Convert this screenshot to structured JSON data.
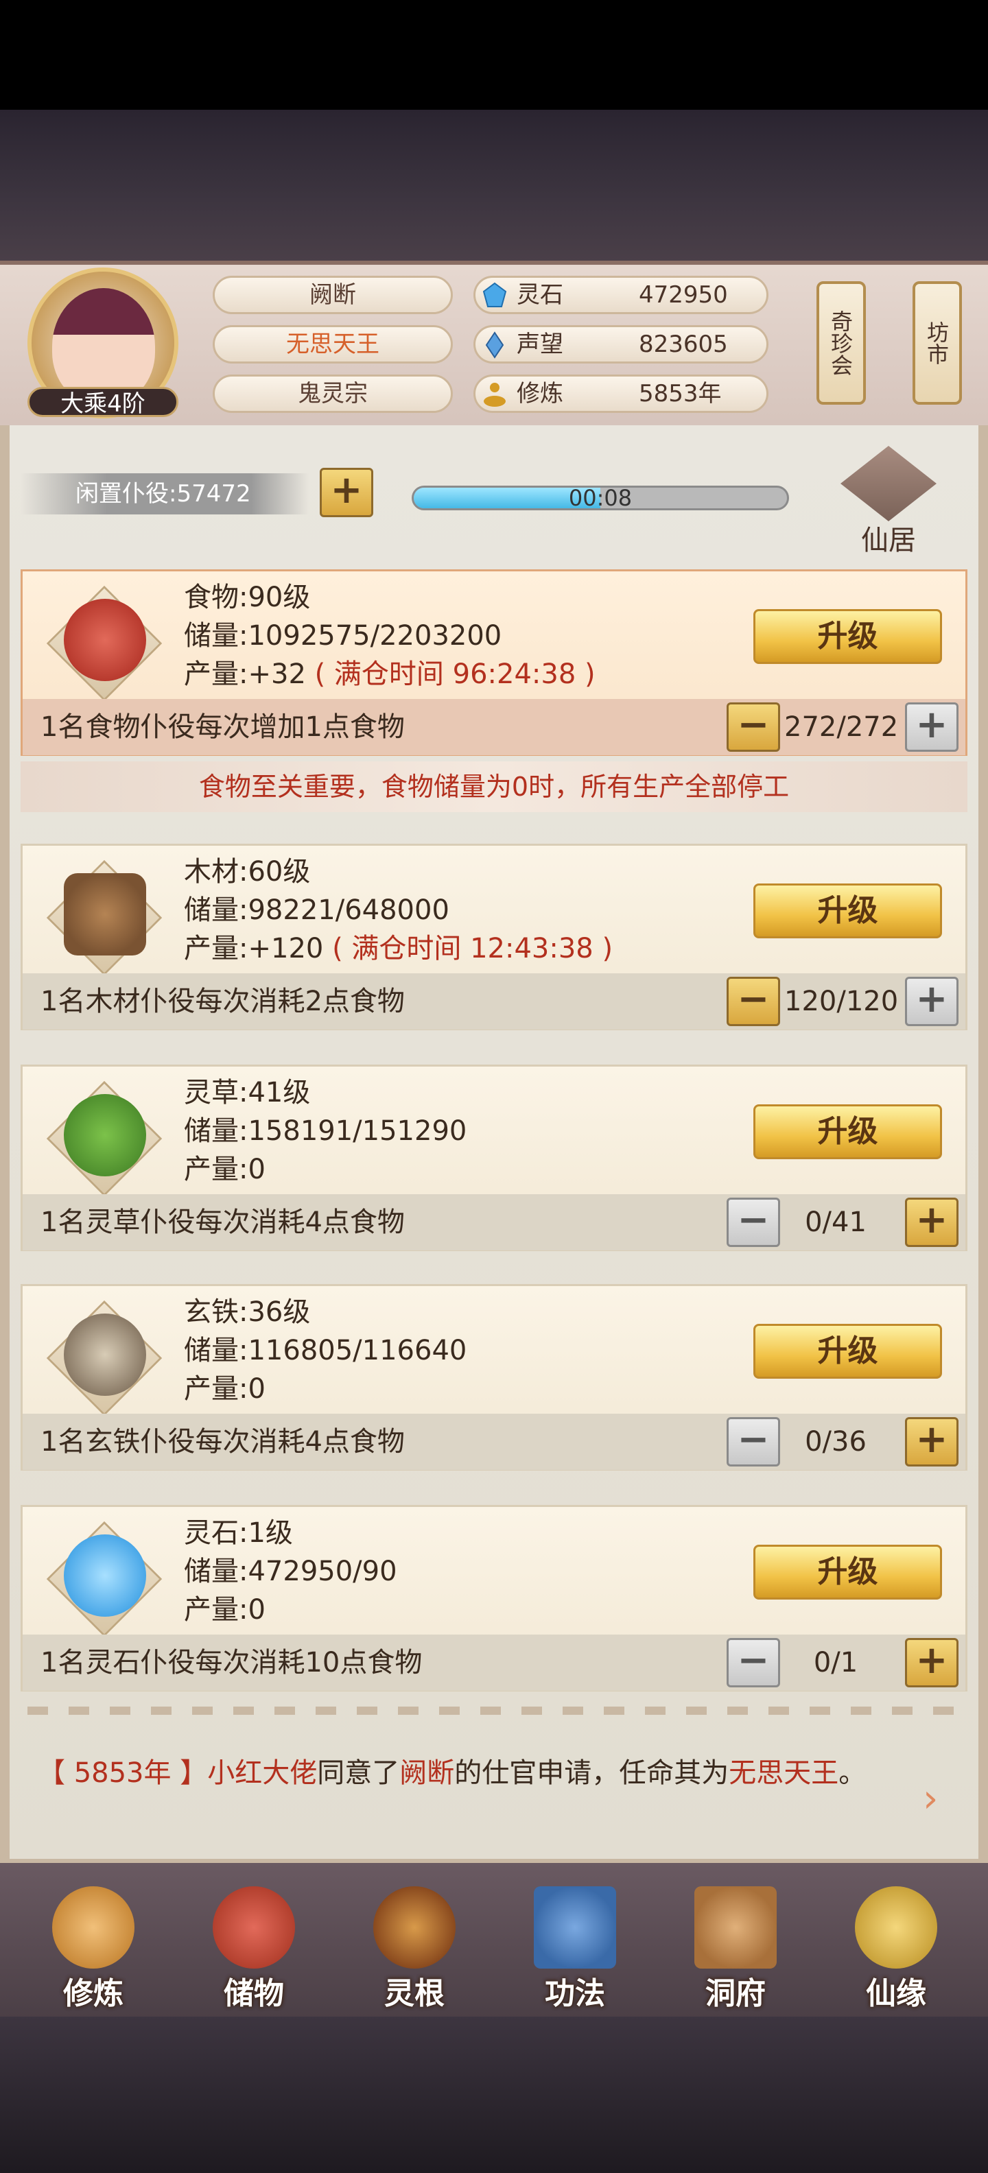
{
  "player": {
    "name": "阙断",
    "title": "无思天王",
    "sect": "鬼灵宗",
    "rank": "大乘4阶"
  },
  "resources": [
    {
      "label": "灵石",
      "value": "472950",
      "icon": "spirit-stone-icon"
    },
    {
      "label": "声望",
      "value": "823605",
      "icon": "reputation-icon"
    },
    {
      "label": "修炼",
      "value": "5853年",
      "icon": "meditation-icon"
    }
  ],
  "side_buttons": {
    "qizhenhui": "奇珍会",
    "fangshi": "坊市"
  },
  "idle": {
    "label": "闲置仆役:57472",
    "add": "+",
    "timer": "00:08",
    "timer_progress": 0.5
  },
  "xianju": {
    "label": "仙居"
  },
  "cards": [
    {
      "name": "食物:90级",
      "storage": "储量:1092575/2203200",
      "output": "产量:+32",
      "full_time": "( 满仓时间 96:24:38 )",
      "upgrade": "升级",
      "worker_desc": "1名食物仆役每次增加1点食物",
      "count": "272/272",
      "minus": "−",
      "plus": "+",
      "icon": "meat-icon",
      "color": "#b83a2e"
    },
    {
      "name": "木材:60级",
      "storage": "储量:98221/648000",
      "output": "产量:+120",
      "full_time": "( 满仓时间 12:43:38 )",
      "upgrade": "升级",
      "worker_desc": "1名木材仆役每次消耗2点食物",
      "count": "120/120",
      "minus": "−",
      "plus": "+",
      "icon": "wood-icon",
      "color": "#7a5332"
    },
    {
      "name": "灵草:41级",
      "storage": "储量:158191/151290",
      "output": "产量:0",
      "full_time": "",
      "upgrade": "升级",
      "worker_desc": "1名灵草仆役每次消耗4点食物",
      "count": "0/41",
      "minus": "−",
      "plus": "+",
      "icon": "herb-icon",
      "color": "#4f8f2e"
    },
    {
      "name": "玄铁:36级",
      "storage": "储量:116805/116640",
      "output": "产量:0",
      "full_time": "",
      "upgrade": "升级",
      "worker_desc": "1名玄铁仆役每次消耗4点食物",
      "count": "0/36",
      "minus": "−",
      "plus": "+",
      "icon": "iron-ore-icon",
      "color": "#8a7a66"
    },
    {
      "name": "灵石:1级",
      "storage": "储量:472950/90",
      "output": "产量:0",
      "full_time": "",
      "upgrade": "升级",
      "worker_desc": "1名灵石仆役每次消耗10点食物",
      "count": "0/1",
      "minus": "−",
      "plus": "+",
      "icon": "crystal-icon",
      "color": "#4aa8e8"
    }
  ],
  "warning": "食物至关重要，食物储量为0时，所有生产全部停工",
  "news": {
    "year": "【 5853年 】",
    "actor": "小红大佬",
    "part1": "同意了",
    "target": "阙断",
    "part2": "的仕官申请，任命其为",
    "title": "无思天王",
    "end": "。"
  },
  "nav": [
    {
      "label": "修炼",
      "icon": "cultivate-icon",
      "color": "#c98a3a"
    },
    {
      "label": "储物",
      "icon": "bag-icon",
      "color": "#b3402e"
    },
    {
      "label": "灵根",
      "icon": "root-icon",
      "color": "#8a4a1e"
    },
    {
      "label": "功法",
      "icon": "book-icon",
      "color": "#3a6aa8"
    },
    {
      "label": "洞府",
      "icon": "cave-icon",
      "color": "#a8703a"
    },
    {
      "label": "仙缘",
      "icon": "fortune-icon",
      "color": "#c9a23a"
    }
  ]
}
